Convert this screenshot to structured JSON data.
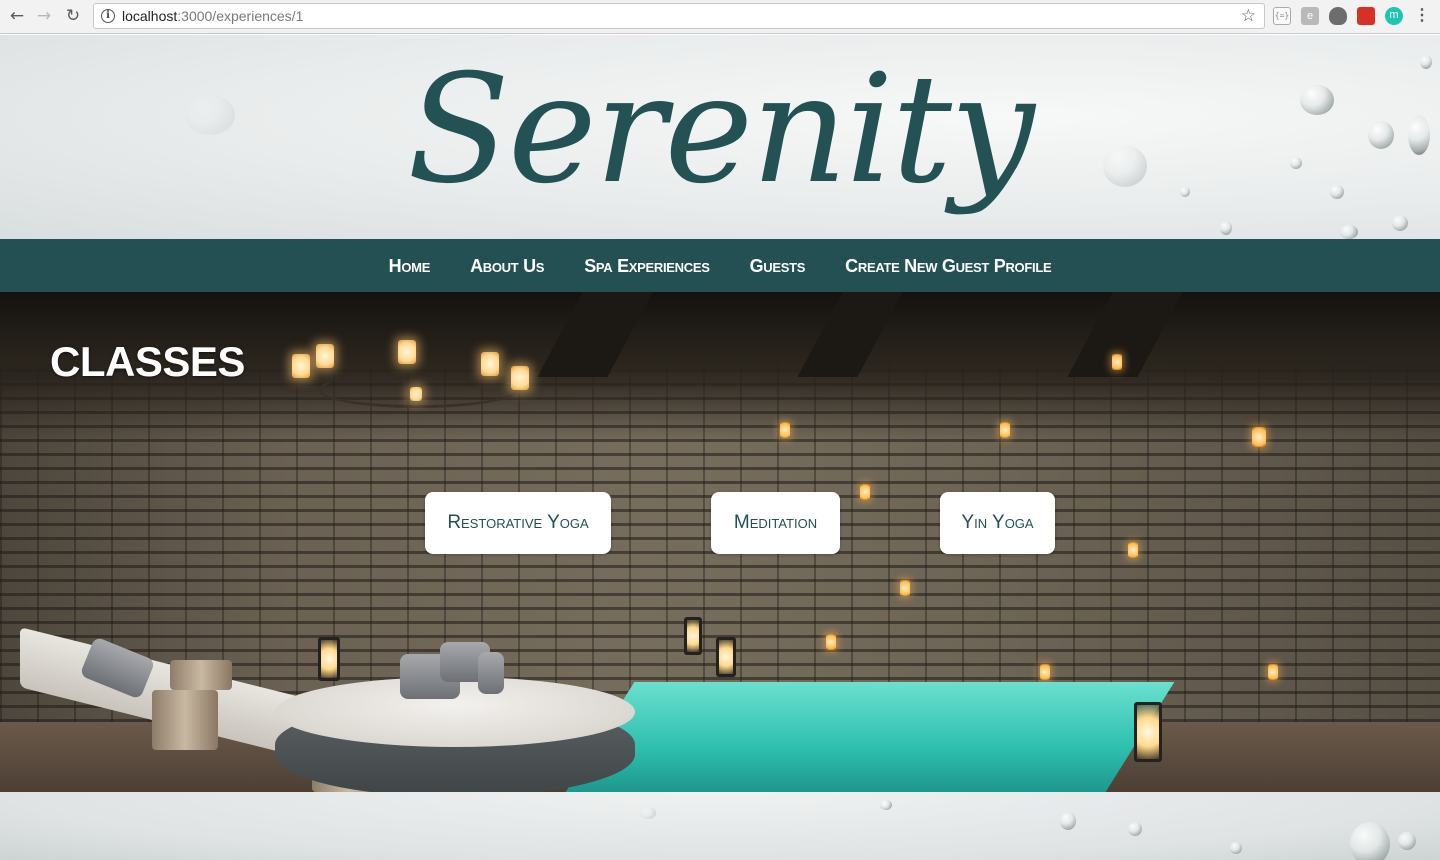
{
  "browser": {
    "url_host": "localhost",
    "url_path": ":3000/experiences/1"
  },
  "site": {
    "logo_text": "Serenity",
    "colors": {
      "brand": "#235154",
      "nav_bg": "#255053",
      "button_bg": "#ffffff"
    }
  },
  "nav": {
    "items": [
      {
        "label": "Home"
      },
      {
        "label": "About Us"
      },
      {
        "label": "Spa Experiences"
      },
      {
        "label": "Guests"
      },
      {
        "label": "Create New Guest Profile"
      }
    ]
  },
  "hero": {
    "title": "CLASSES",
    "classes": [
      {
        "label": "Restorative Yoga"
      },
      {
        "label": "Meditation"
      },
      {
        "label": "Yin Yoga"
      }
    ]
  }
}
